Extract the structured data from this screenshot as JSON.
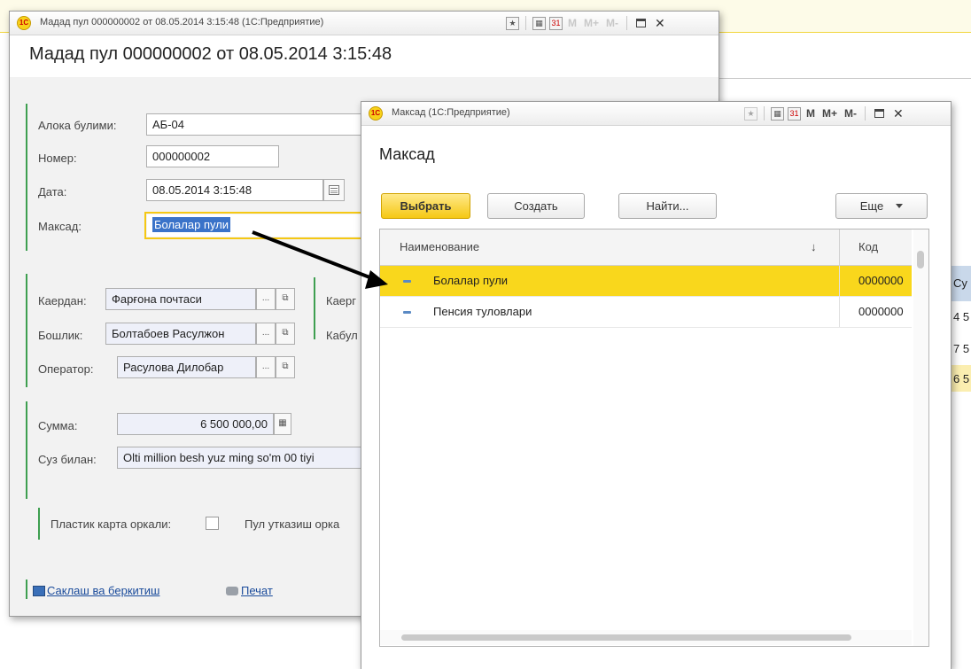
{
  "doc_window": {
    "title_bar": "Мадад пул 000000002 от 08.05.2014 3:15:48 (1С:Предприятие)",
    "heading": "Мадад пул 000000002 от 08.05.2014 3:15:48",
    "fields": {
      "aloka_label": "Алока булими:",
      "aloka_value": "АБ-04",
      "nomer_label": "Номер:",
      "nomer_value": "000000002",
      "data_label": "Дата:",
      "data_value": "08.05.2014  3:15:48",
      "maqsad_label": "Максад:",
      "maqsad_value": "Болалар пули",
      "kaerdan_label": "Каердан:",
      "kaerdan_value": "Фарғона почтаси",
      "kaerga_label": "Каерг",
      "boshlik_label": "Бошлик:",
      "boshlik_value": "Болтабоев Расулжон",
      "kabul_label": "Кабул",
      "operator_label": "Оператор:",
      "operator_value": "Расулова Дилобар",
      "summa_label": "Сумма:",
      "summa_value": "6 500 000,00",
      "suz_label": "Суз билан:",
      "suz_value": "Olti million besh yuz ming so'm 00 tiyi",
      "plastik_label": "Пластик карта оркали:",
      "pul_label": "Пул утказиш орка"
    },
    "links": {
      "save": "Саклаш ва беркитиш",
      "print": "Печат"
    }
  },
  "choice_window": {
    "title_bar": "Максад  (1С:Предприятие)",
    "heading": "Максад",
    "buttons": {
      "select": "Выбрать",
      "create": "Создать",
      "find": "Найти...",
      "more": "Еще"
    },
    "table": {
      "headers": {
        "name": "Наименование",
        "sort": "↓",
        "code": "Код"
      },
      "rows": [
        {
          "name": "Болалар пули",
          "code": "0000000"
        },
        {
          "name": "Пенсия туловлари",
          "code": "0000000"
        }
      ]
    }
  },
  "titlebar_buttons": {
    "m": "M",
    "mplus": "M+",
    "mminus": "M-",
    "calendar_day": "31"
  },
  "background_cells": [
    "Су",
    "4 5",
    "7 5",
    "6 5"
  ],
  "colors": {
    "accent_yellow": "#f9d71c",
    "group_bar_green": "#3e9f50",
    "link_blue": "#1a4b9b"
  }
}
